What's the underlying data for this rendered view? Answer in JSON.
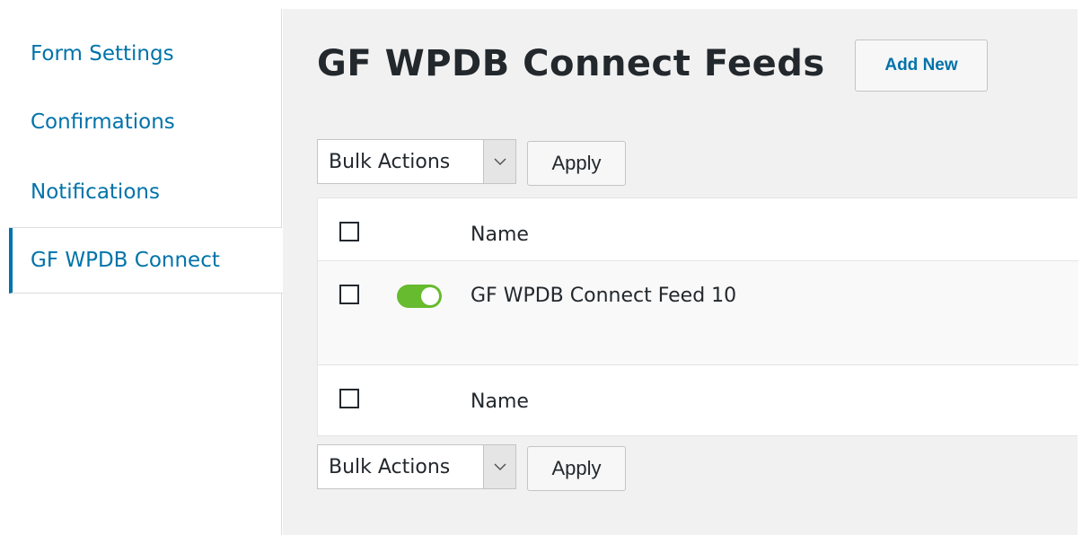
{
  "sidebar": {
    "items": [
      {
        "label": "Form Settings"
      },
      {
        "label": "Confirmations"
      },
      {
        "label": "Notifications"
      },
      {
        "label": "GF WPDB Connect"
      }
    ],
    "active": "GF WPDB Connect"
  },
  "main": {
    "title": "GF WPDB Connect Feeds",
    "add_new_label": "Add New",
    "bulk_top": {
      "select_label": "Bulk Actions",
      "apply_label": "Apply"
    },
    "bulk_bottom": {
      "select_label": "Bulk Actions",
      "apply_label": "Apply"
    },
    "table": {
      "header_column": "Name",
      "footer_column": "Name",
      "rows": [
        {
          "name": "GF WPDB Connect Feed 10",
          "active": true
        }
      ]
    }
  },
  "colors": {
    "link": "#0073aa",
    "toggle_on": "#66bb2e",
    "background": "#f1f1f1"
  },
  "icons": {
    "select_chevron": "chevron-down-icon",
    "feed_toggle": "toggle-on-icon"
  }
}
